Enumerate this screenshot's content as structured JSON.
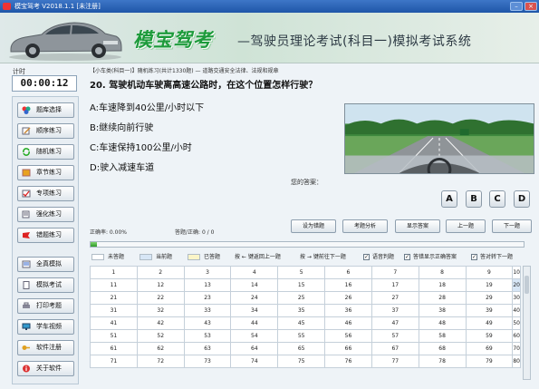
{
  "window": {
    "title": "模宝驾考 V2018.1.1 [未注册]"
  },
  "banner": {
    "brand": "模宝驾考",
    "subtitle": "—驾驶员理论考试(科目一)模拟考试系统"
  },
  "timer": {
    "label": "计时",
    "value": "00:00:12"
  },
  "sidebar": {
    "items": [
      {
        "label": "题库选择",
        "icon": "colored-dots-icon"
      },
      {
        "label": "顺序练习",
        "icon": "pencil-icon"
      },
      {
        "label": "随机练习",
        "icon": "recycle-icon"
      },
      {
        "label": "章节练习",
        "icon": "book-icon"
      },
      {
        "label": "专项练习",
        "icon": "check-icon"
      },
      {
        "label": "强化练习",
        "icon": "pen-paper-icon"
      },
      {
        "label": "错题练习",
        "icon": "red-flag-icon"
      },
      {
        "label": "全真模拟",
        "icon": "list-icon"
      },
      {
        "label": "模拟考试",
        "icon": "document-icon"
      },
      {
        "label": "打印考题",
        "icon": "printer-icon"
      },
      {
        "label": "学车视频",
        "icon": "monitor-icon"
      },
      {
        "label": "软件注册",
        "icon": "key-icon"
      },
      {
        "label": "关于软件",
        "icon": "info-icon"
      }
    ]
  },
  "main": {
    "breadcrumb": "【小车类(科目一)】随机练习(共计1330题) — 道路交通安全法律、法规和规章",
    "question": "20. 驾驶机动车驶离高速公路时，在这个位置怎样行驶？",
    "options": [
      "A:车速降到40公里/小时以下",
      "B:继续向前行驶",
      "C:车速保持100公里/小时",
      "D:驶入减速车道"
    ],
    "answer_label": "您的答案：",
    "answer_buttons": [
      "A",
      "B",
      "C",
      "D"
    ],
    "accuracy": "正确率: 0.00%",
    "answered": "答题/正确: 0 / 0",
    "buttons": {
      "mark_wrong": "设为错题",
      "analysis": "考题分析",
      "show_answer": "显示答案",
      "prev": "上一题",
      "next": "下一题"
    },
    "progress": 0.015,
    "legend": {
      "unanswered": "未答题",
      "current": "当前题",
      "answered": "已答题",
      "key_prev": "按 ← 键返回上一题",
      "key_next": "按 → 键前往下一题",
      "voice": "语音判题",
      "show_correct": "答错显示正确答案",
      "auto_next": "答对转下一题"
    },
    "current_question": 20,
    "grid": [
      [
        "1",
        "2",
        "3",
        "4",
        "5",
        "6",
        "7",
        "8",
        "9",
        "10"
      ],
      [
        "11",
        "12",
        "13",
        "14",
        "15",
        "16",
        "17",
        "18",
        "19",
        "20"
      ],
      [
        "21",
        "22",
        "23",
        "24",
        "25",
        "26",
        "27",
        "28",
        "29",
        "30"
      ],
      [
        "31",
        "32",
        "33",
        "34",
        "35",
        "36",
        "37",
        "38",
        "39",
        "40"
      ],
      [
        "41",
        "42",
        "43",
        "44",
        "45",
        "46",
        "47",
        "48",
        "49",
        "50"
      ],
      [
        "51",
        "52",
        "53",
        "54",
        "55",
        "56",
        "57",
        "58",
        "59",
        "60"
      ],
      [
        "61",
        "62",
        "63",
        "64",
        "65",
        "66",
        "67",
        "68",
        "69",
        "70"
      ],
      [
        "71",
        "72",
        "73",
        "74",
        "75",
        "76",
        "77",
        "78",
        "79",
        "80"
      ]
    ]
  },
  "colors": {
    "brand": "#1d9b3b",
    "current_cell": "#d7e6f6",
    "titlebar": "#1f56a8"
  }
}
